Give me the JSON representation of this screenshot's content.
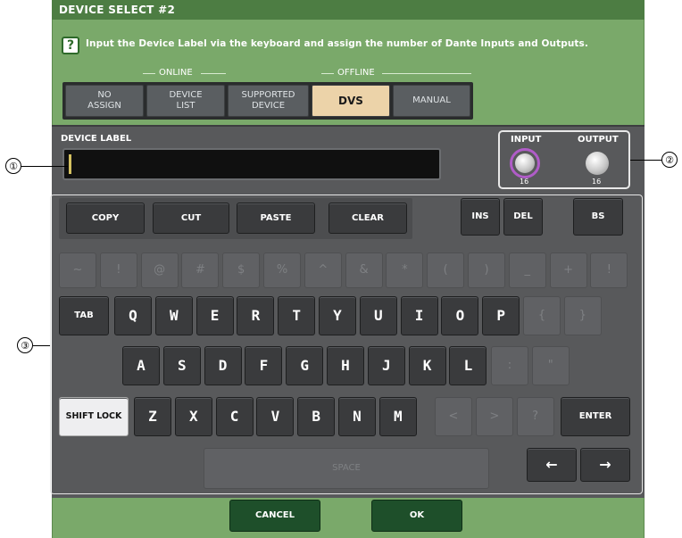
{
  "dialog": {
    "title": "DEVICE SELECT #2",
    "help_icon": "?",
    "help_text": "Input the Device Label via the keyboard and assign the number of Dante Inputs and Outputs.",
    "group_online": "ONLINE",
    "group_offline": "OFFLINE"
  },
  "modes": [
    {
      "label": "NO\nASSIGN",
      "selected": false
    },
    {
      "label": "DEVICE\nLIST",
      "selected": false
    },
    {
      "label": "SUPPORTED\nDEVICE",
      "selected": false
    },
    {
      "label": "DVS",
      "selected": true
    },
    {
      "label": "MANUAL",
      "selected": false
    }
  ],
  "device_label": {
    "title": "DEVICE LABEL",
    "value": ""
  },
  "io": {
    "input_label": "INPUT",
    "input_value": "16",
    "output_label": "OUTPUT",
    "output_value": "16"
  },
  "callouts": [
    "①",
    "②",
    "③"
  ],
  "edit_keys": {
    "copy": "COPY",
    "cut": "CUT",
    "paste": "PASTE",
    "clear": "CLEAR",
    "ins": "INS",
    "del": "DEL",
    "bs": "BS"
  },
  "symbol_row": [
    "~",
    "!",
    "@",
    "#",
    "$",
    "%",
    "^",
    "&",
    "*",
    "(",
    ")",
    "_",
    "+",
    "!"
  ],
  "row_q": {
    "tab": "TAB",
    "keys": [
      "Q",
      "W",
      "E",
      "R",
      "T",
      "Y",
      "U",
      "I",
      "O",
      "P"
    ],
    "disabled": [
      "{",
      "}"
    ]
  },
  "row_a": {
    "keys": [
      "A",
      "S",
      "D",
      "F",
      "G",
      "H",
      "J",
      "K",
      "L"
    ],
    "disabled": [
      ":",
      "\""
    ]
  },
  "row_z": {
    "shift": "SHIFT LOCK",
    "keys": [
      "Z",
      "X",
      "C",
      "V",
      "B",
      "N",
      "M"
    ],
    "disabled": [
      "<",
      ">",
      "?"
    ],
    "enter": "ENTER"
  },
  "space": "SPACE",
  "arrows": {
    "left": "←",
    "right": "→"
  },
  "footer": {
    "cancel": "CANCEL",
    "ok": "OK"
  },
  "colors": {
    "dialog_green": "#7aa96a",
    "panel_gray": "#58595b",
    "selected_tab": "#ecd3a9",
    "footer_button": "#1e4f2a",
    "input_knob_ring": "#b05cc8"
  }
}
